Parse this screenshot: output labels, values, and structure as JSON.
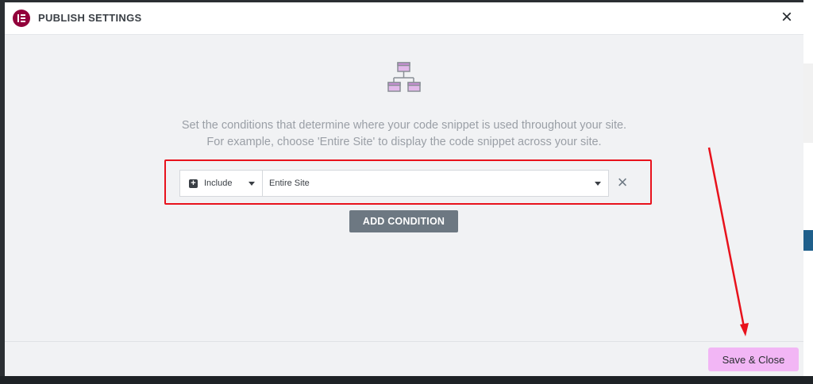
{
  "modal": {
    "title": "PUBLISH SETTINGS",
    "logo_color": "#92003b"
  },
  "content": {
    "description_line1": "Set the conditions that determine where your code snippet is used throughout your site.",
    "description_line2": "For example, choose 'Entire Site' to display the code snippet across your site.",
    "icon": "sitemap-icon",
    "icon_accent": "#e2b8ea"
  },
  "condition": {
    "type_label": "Include",
    "value_label": "Entire Site",
    "highlight_color": "#e8121c"
  },
  "actions": {
    "add_condition_label": "ADD CONDITION",
    "save_close_label": "Save & Close",
    "save_color": "#f2b6f5"
  }
}
